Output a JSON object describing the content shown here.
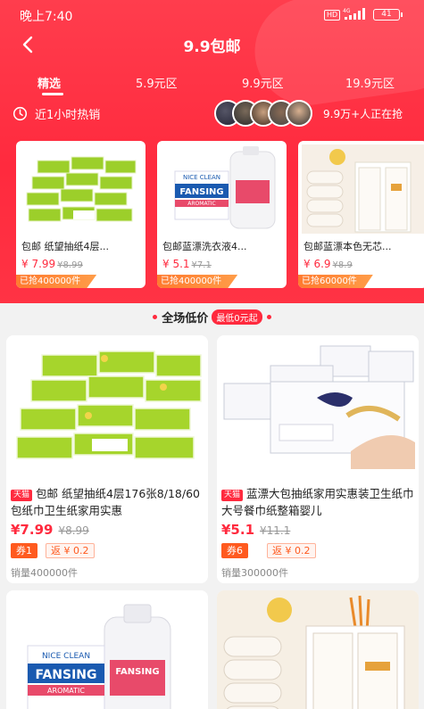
{
  "status_bar": {
    "time": "晚上7:40",
    "hd": "HD",
    "net": "4G",
    "battery": "41"
  },
  "page": {
    "title": "9.9包邮"
  },
  "tabs": [
    {
      "label": "精选",
      "active": true
    },
    {
      "label": "5.9元区",
      "active": false
    },
    {
      "label": "9.9元区",
      "active": false
    },
    {
      "label": "19.9元区",
      "active": false
    }
  ],
  "hot": {
    "label": "近1小时热销",
    "online": "9.9万+人正在抢"
  },
  "hot_cards": [
    {
      "name": "包邮 纸望抽纸4层...",
      "price": "¥ 7.99",
      "old": "¥8.99",
      "sold": "已抢400000件"
    },
    {
      "name": "包邮蓝漂洗衣液4...",
      "price": "¥ 5.1",
      "old": "¥7.1",
      "sold": "已抢400000件"
    },
    {
      "name": "包邮蓝漂本色无芯...",
      "price": "¥ 6.9",
      "old": "¥8.9",
      "sold": "已抢60000件"
    }
  ],
  "section": {
    "title": "全场低价",
    "tag": "最低0元起"
  },
  "products": [
    {
      "tag": "天猫",
      "name": "包邮 纸望抽纸4层176张8/18/60包纸巾卫生纸家用实惠",
      "price": "¥7.99",
      "old": "¥8.99",
      "coupon": "券1",
      "rebate": "返 ¥ 0.2",
      "sales": "销量400000件"
    },
    {
      "tag": "天猫",
      "name": "蓝漂大包抽纸家用实惠装卫生纸巾大号餐巾纸整箱婴儿",
      "price": "¥5.1",
      "old": "¥11.1",
      "coupon": "券6",
      "rebate": "返 ¥ 0.2",
      "sales": "销量300000件"
    }
  ],
  "product_images": {
    "brand": "NICE CLEAN",
    "name": "FANSING",
    "sub": "AROMATIC"
  },
  "colors": {
    "accent": "#ff2a3e",
    "coupon": "#ff5a1f"
  }
}
